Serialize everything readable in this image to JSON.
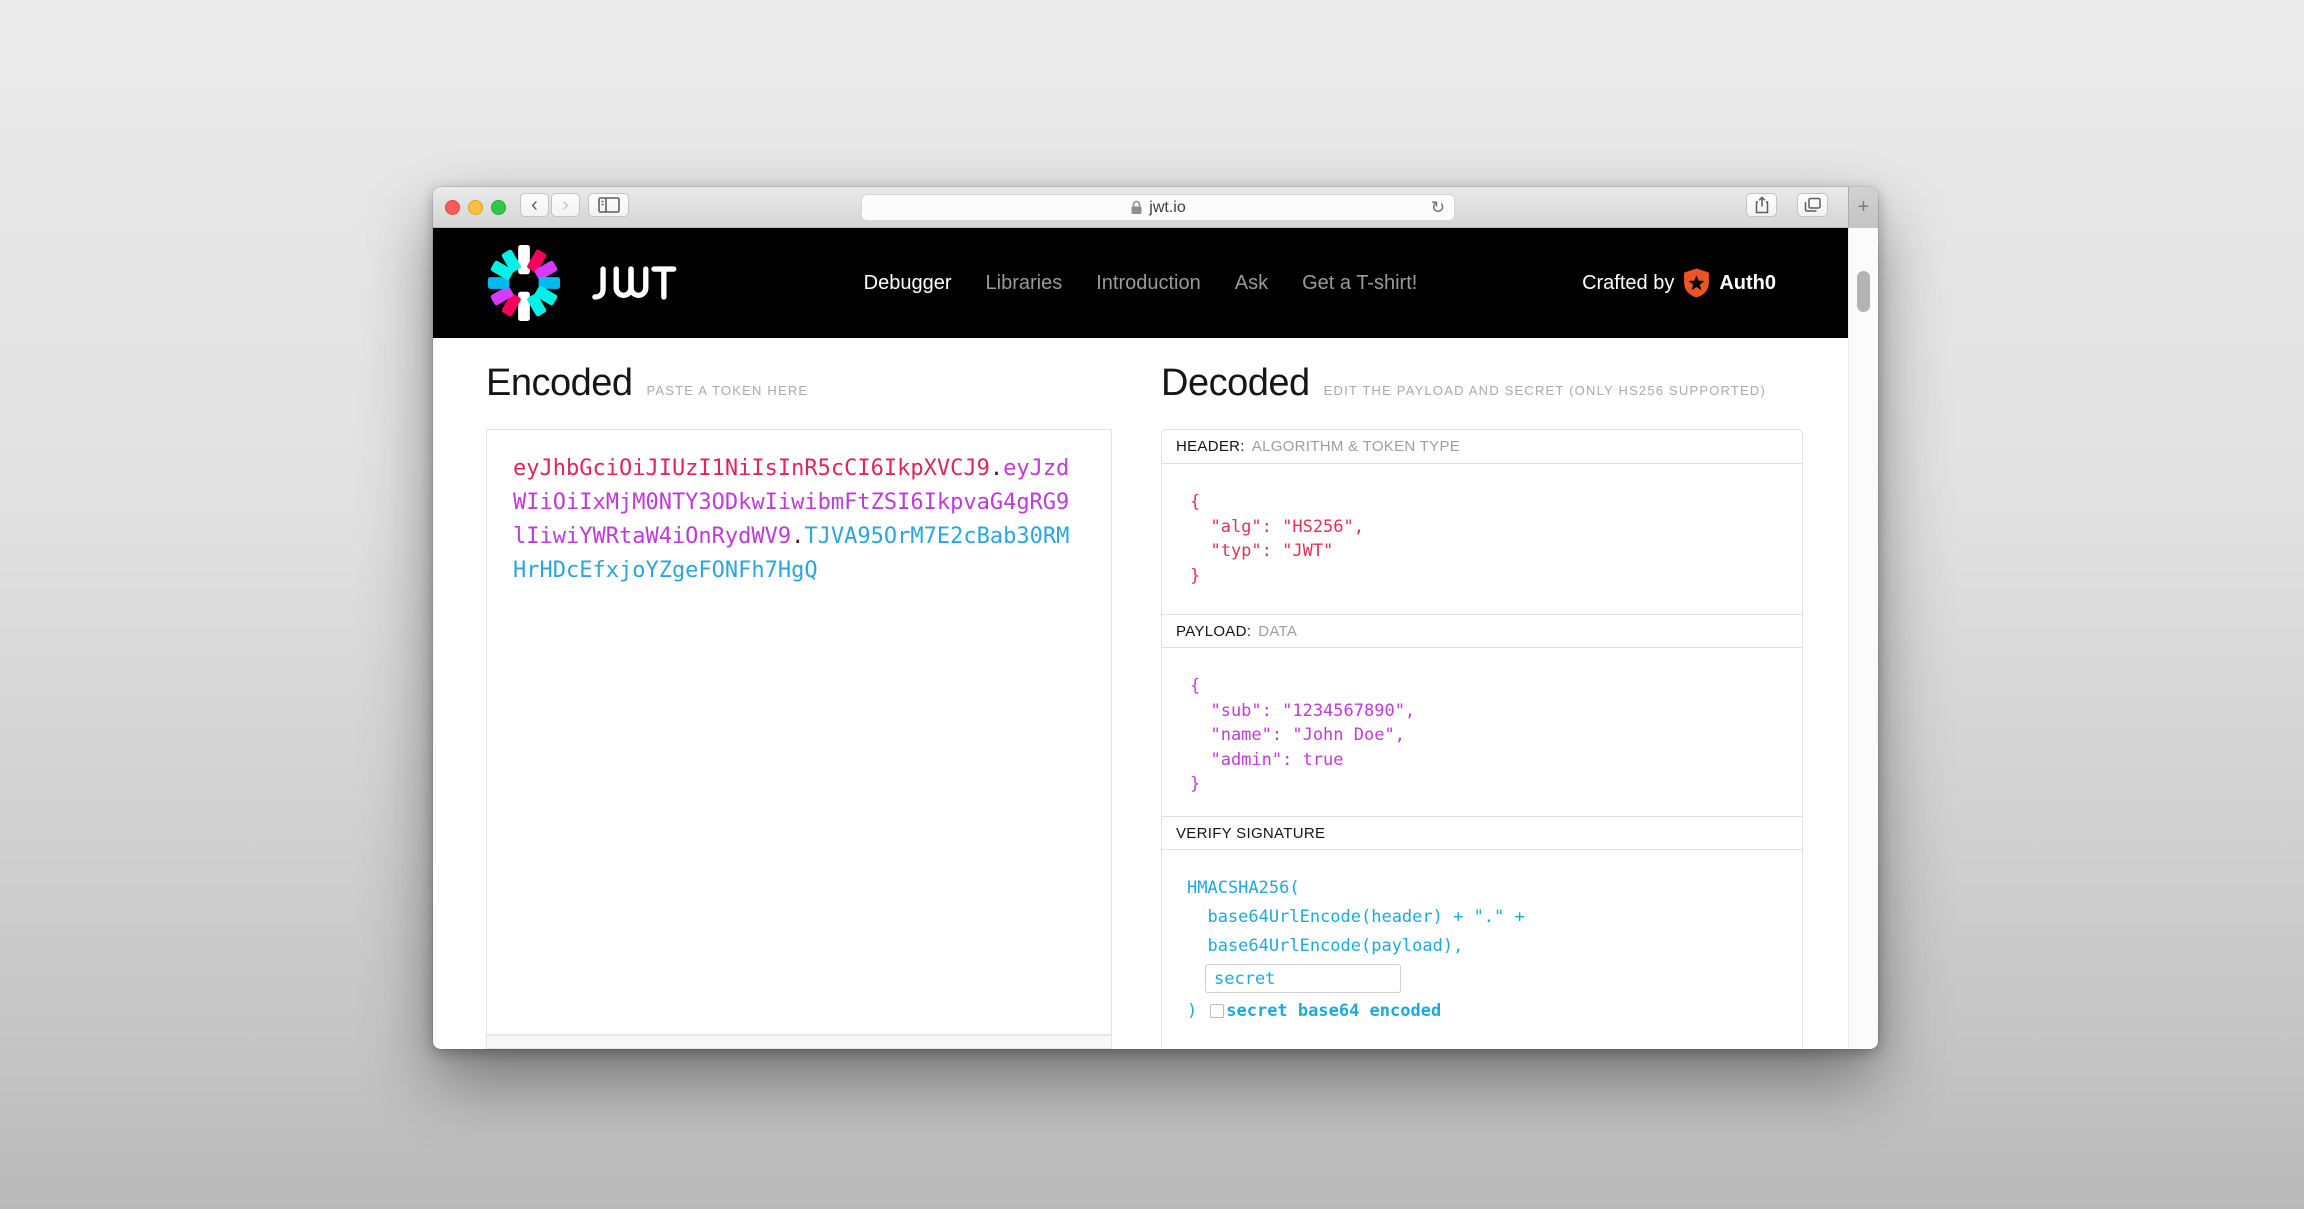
{
  "browser": {
    "url": "jwt.io",
    "new_tab_label": "+",
    "back_glyph": "‹",
    "forward_glyph": "›",
    "reload_glyph": "↻"
  },
  "nav": {
    "brand": "JWT",
    "items": [
      {
        "label": "Debugger",
        "active": true
      },
      {
        "label": "Libraries",
        "active": false
      },
      {
        "label": "Introduction",
        "active": false
      },
      {
        "label": "Ask",
        "active": false
      },
      {
        "label": "Get a T-shirt!",
        "active": false
      }
    ],
    "crafted_by": "Crafted by",
    "crafted_brand": "Auth0"
  },
  "encoded": {
    "title": "Encoded",
    "subtitle": "PASTE A TOKEN HERE",
    "token": {
      "header": "eyJhbGciOiJIUzI1NiIsInR5cCI6IkpXVCJ9",
      "dot1": ".",
      "payload": "eyJzdWIiOiIxMjM0NTY3ODkwIiwibmFtZSI6IkpvaG4gRG9lIiwiYWRtaW4iOnRydWV9",
      "dot2": ".",
      "signature": "TJVA95OrM7E2cBab30RMHrHDcEfxjoYZgeFONFh7HgQ"
    }
  },
  "decoded": {
    "title": "Decoded",
    "subtitle": "EDIT THE PAYLOAD AND SECRET (ONLY HS256 SUPPORTED)",
    "header_section": {
      "label": "HEADER:",
      "sublabel": "ALGORITHM & TOKEN TYPE",
      "json": "{\n  \"alg\": \"HS256\",\n  \"typ\": \"JWT\"\n}"
    },
    "payload_section": {
      "label": "PAYLOAD:",
      "sublabel": "DATA",
      "json": "{\n  \"sub\": \"1234567890\",\n  \"name\": \"John Doe\",\n  \"admin\": true\n}"
    },
    "verify_section": {
      "label": "VERIFY SIGNATURE",
      "code": "HMACSHA256(\n  base64UrlEncode(header) + \".\" +\n  base64UrlEncode(payload),",
      "secret_value": "secret",
      "close_paren": ")",
      "checkbox_checked": false,
      "checkbox_label": "secret base64 encoded"
    }
  },
  "colors": {
    "token_header": "#e0245c",
    "token_payload": "#bf3bd9",
    "token_signature": "#2aa6dc",
    "auth0_orange": "#eb5424",
    "logo_pink": "#f5015b",
    "logo_purple": "#d63aff",
    "logo_blue": "#00b9f1",
    "logo_teal": "#00f2e6"
  }
}
